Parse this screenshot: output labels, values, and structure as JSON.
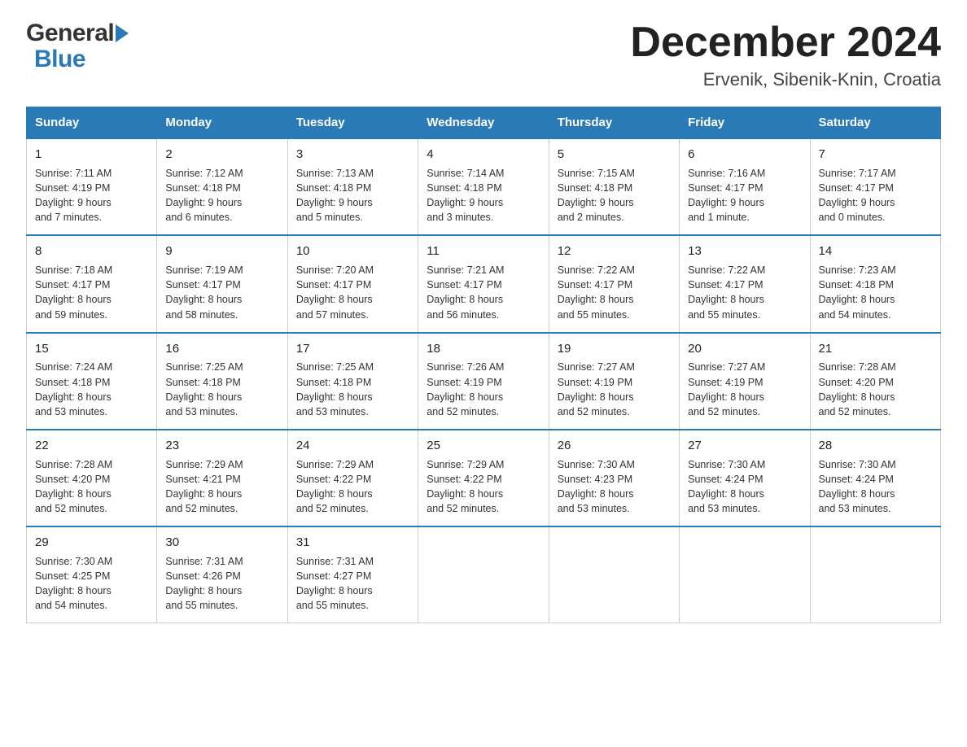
{
  "header": {
    "title": "December 2024",
    "location": "Ervenik, Sibenik-Knin, Croatia",
    "logo_general": "General",
    "logo_blue": "Blue"
  },
  "weekdays": [
    "Sunday",
    "Monday",
    "Tuesday",
    "Wednesday",
    "Thursday",
    "Friday",
    "Saturday"
  ],
  "weeks": [
    [
      {
        "day": "1",
        "sunrise": "7:11 AM",
        "sunset": "4:19 PM",
        "daylight": "9 hours and 7 minutes."
      },
      {
        "day": "2",
        "sunrise": "7:12 AM",
        "sunset": "4:18 PM",
        "daylight": "9 hours and 6 minutes."
      },
      {
        "day": "3",
        "sunrise": "7:13 AM",
        "sunset": "4:18 PM",
        "daylight": "9 hours and 5 minutes."
      },
      {
        "day": "4",
        "sunrise": "7:14 AM",
        "sunset": "4:18 PM",
        "daylight": "9 hours and 3 minutes."
      },
      {
        "day": "5",
        "sunrise": "7:15 AM",
        "sunset": "4:18 PM",
        "daylight": "9 hours and 2 minutes."
      },
      {
        "day": "6",
        "sunrise": "7:16 AM",
        "sunset": "4:17 PM",
        "daylight": "9 hours and 1 minute."
      },
      {
        "day": "7",
        "sunrise": "7:17 AM",
        "sunset": "4:17 PM",
        "daylight": "9 hours and 0 minutes."
      }
    ],
    [
      {
        "day": "8",
        "sunrise": "7:18 AM",
        "sunset": "4:17 PM",
        "daylight": "8 hours and 59 minutes."
      },
      {
        "day": "9",
        "sunrise": "7:19 AM",
        "sunset": "4:17 PM",
        "daylight": "8 hours and 58 minutes."
      },
      {
        "day": "10",
        "sunrise": "7:20 AM",
        "sunset": "4:17 PM",
        "daylight": "8 hours and 57 minutes."
      },
      {
        "day": "11",
        "sunrise": "7:21 AM",
        "sunset": "4:17 PM",
        "daylight": "8 hours and 56 minutes."
      },
      {
        "day": "12",
        "sunrise": "7:22 AM",
        "sunset": "4:17 PM",
        "daylight": "8 hours and 55 minutes."
      },
      {
        "day": "13",
        "sunrise": "7:22 AM",
        "sunset": "4:17 PM",
        "daylight": "8 hours and 55 minutes."
      },
      {
        "day": "14",
        "sunrise": "7:23 AM",
        "sunset": "4:18 PM",
        "daylight": "8 hours and 54 minutes."
      }
    ],
    [
      {
        "day": "15",
        "sunrise": "7:24 AM",
        "sunset": "4:18 PM",
        "daylight": "8 hours and 53 minutes."
      },
      {
        "day": "16",
        "sunrise": "7:25 AM",
        "sunset": "4:18 PM",
        "daylight": "8 hours and 53 minutes."
      },
      {
        "day": "17",
        "sunrise": "7:25 AM",
        "sunset": "4:18 PM",
        "daylight": "8 hours and 53 minutes."
      },
      {
        "day": "18",
        "sunrise": "7:26 AM",
        "sunset": "4:19 PM",
        "daylight": "8 hours and 52 minutes."
      },
      {
        "day": "19",
        "sunrise": "7:27 AM",
        "sunset": "4:19 PM",
        "daylight": "8 hours and 52 minutes."
      },
      {
        "day": "20",
        "sunrise": "7:27 AM",
        "sunset": "4:19 PM",
        "daylight": "8 hours and 52 minutes."
      },
      {
        "day": "21",
        "sunrise": "7:28 AM",
        "sunset": "4:20 PM",
        "daylight": "8 hours and 52 minutes."
      }
    ],
    [
      {
        "day": "22",
        "sunrise": "7:28 AM",
        "sunset": "4:20 PM",
        "daylight": "8 hours and 52 minutes."
      },
      {
        "day": "23",
        "sunrise": "7:29 AM",
        "sunset": "4:21 PM",
        "daylight": "8 hours and 52 minutes."
      },
      {
        "day": "24",
        "sunrise": "7:29 AM",
        "sunset": "4:22 PM",
        "daylight": "8 hours and 52 minutes."
      },
      {
        "day": "25",
        "sunrise": "7:29 AM",
        "sunset": "4:22 PM",
        "daylight": "8 hours and 52 minutes."
      },
      {
        "day": "26",
        "sunrise": "7:30 AM",
        "sunset": "4:23 PM",
        "daylight": "8 hours and 53 minutes."
      },
      {
        "day": "27",
        "sunrise": "7:30 AM",
        "sunset": "4:24 PM",
        "daylight": "8 hours and 53 minutes."
      },
      {
        "day": "28",
        "sunrise": "7:30 AM",
        "sunset": "4:24 PM",
        "daylight": "8 hours and 53 minutes."
      }
    ],
    [
      {
        "day": "29",
        "sunrise": "7:30 AM",
        "sunset": "4:25 PM",
        "daylight": "8 hours and 54 minutes."
      },
      {
        "day": "30",
        "sunrise": "7:31 AM",
        "sunset": "4:26 PM",
        "daylight": "8 hours and 55 minutes."
      },
      {
        "day": "31",
        "sunrise": "7:31 AM",
        "sunset": "4:27 PM",
        "daylight": "8 hours and 55 minutes."
      },
      null,
      null,
      null,
      null
    ]
  ],
  "labels": {
    "sunrise": "Sunrise:",
    "sunset": "Sunset:",
    "daylight": "Daylight:"
  }
}
